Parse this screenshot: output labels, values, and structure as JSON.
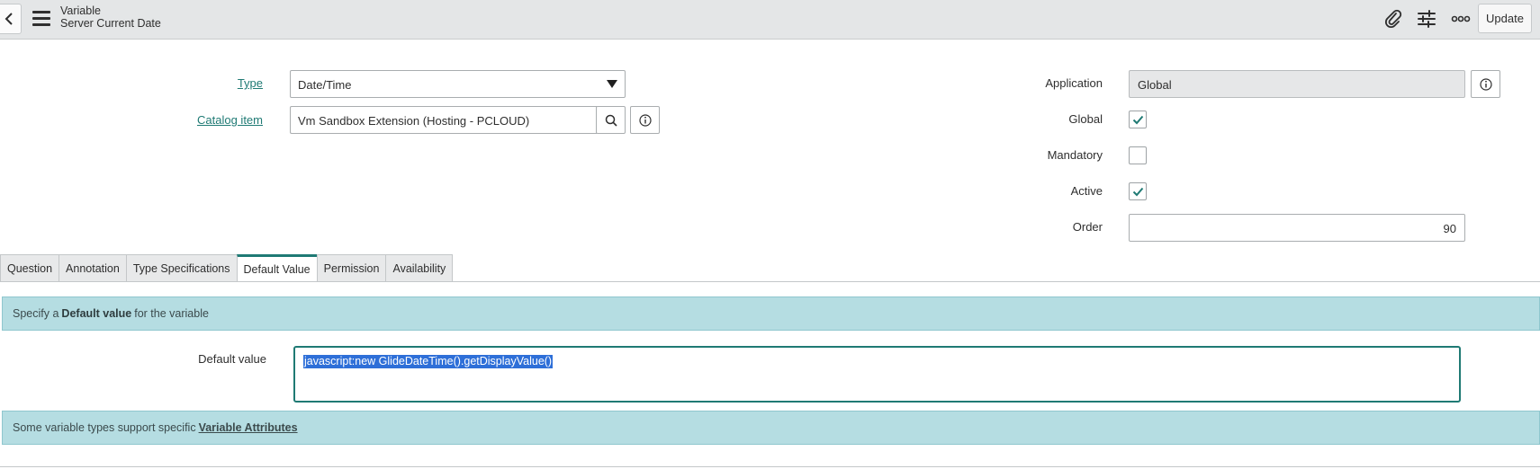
{
  "header": {
    "title": "Variable",
    "subtitle": "Server Current Date",
    "update_label": "Update",
    "icons": [
      "chevron-left-icon",
      "hamburger-menu-icon",
      "paperclip-icon",
      "sliders-icon",
      "more-options-icon"
    ]
  },
  "form": {
    "type_label": "Type",
    "type_value": "Date/Time",
    "catalog_label": "Catalog item",
    "catalog_value": "Vm Sandbox Extension (Hosting - PCLOUD)",
    "application_label": "Application",
    "application_value": "Global",
    "global_label": "Global",
    "global_checked": true,
    "mandatory_label": "Mandatory",
    "mandatory_checked": false,
    "active_label": "Active",
    "active_checked": true,
    "order_label": "Order",
    "order_value": "90"
  },
  "tabs": [
    {
      "label": "Question"
    },
    {
      "label": "Annotation"
    },
    {
      "label": "Type Specifications"
    },
    {
      "label": "Default Value",
      "active": true
    },
    {
      "label": "Permission"
    },
    {
      "label": "Availability"
    }
  ],
  "default_tab": {
    "info_prefix": "Specify a",
    "info_bold": "Default value",
    "info_suffix": "for the variable",
    "default_value_label": "Default value",
    "default_value": "javascript:new GlideDateTime().getDisplayValue()",
    "attr_prefix": "Some variable types support specific",
    "attr_link": "Variable Attributes"
  },
  "colors": {
    "accent": "#1f7a74",
    "banner": "#b5dde2",
    "header_bg": "#e4e6e7",
    "selection": "#2e6fd8"
  }
}
